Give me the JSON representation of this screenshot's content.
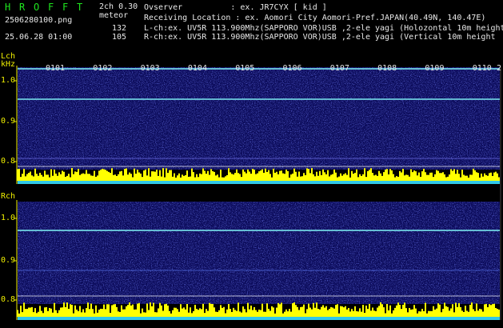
{
  "header": {
    "app_letters": [
      "H",
      "R",
      "O",
      "F",
      "F",
      "T"
    ],
    "mode": "2ch 0.30",
    "category": "meteor",
    "filename": "2506280100.png",
    "datetime": "25.06.28 01:00",
    "lch_count": "132",
    "rch_count": "105",
    "observer_line": "Ovserver          : ex. JR7CYX [ kid ]",
    "location_line": "Receiving Location : ex. Aomori City Aomori-Pref.JAPAN(40.49N, 140.47E)",
    "lch_info": "L-ch:ex. UV5R 113.900Mhz(SAPPORO VOR)USB ,2-ele yagi (Holozontal 10m height",
    "rch_info": "R-ch:ex. UV5R 113.900Mhz(SAPPORO VOR)USB ,2-ele yagi (Vertical 10m height"
  },
  "time_marks": [
    "0101",
    "0102",
    "0103",
    "0104",
    "0105",
    "0106",
    "0107",
    "0108",
    "0109",
    "0110"
  ],
  "time_mark_end": "2",
  "left_panel": {
    "label": "Lch",
    "unit": "kHz",
    "ticks": [
      "1.0",
      "0.9",
      "0.8"
    ]
  },
  "right_panel": {
    "label": "Rch",
    "ticks": [
      "1.0",
      "0.9",
      "0.8"
    ]
  },
  "colors": {
    "background": "#000000",
    "header_green": "#1fe51f",
    "axis_yellow": "#f0f000",
    "waterfall_base": "#0b0b5a",
    "signal_line": "#6fd0e0",
    "level_bar": "#ffff00",
    "level_base": "#30c8e8"
  }
}
